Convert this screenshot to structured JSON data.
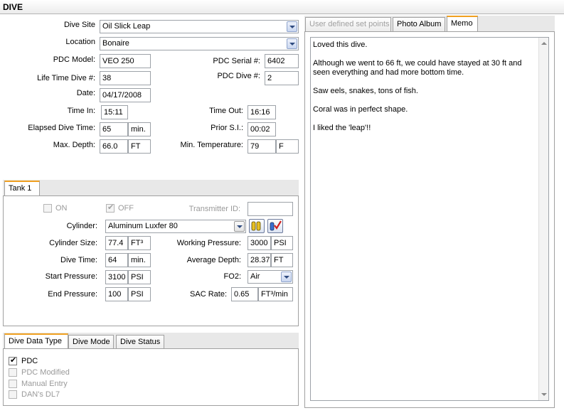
{
  "window": {
    "title": "DIVE"
  },
  "dive": {
    "dive_site_label": "Dive Site",
    "dive_site_value": "Oil Slick Leap",
    "location_label": "Location",
    "location_value": "Bonaire",
    "pdc_model_label": "PDC Model:",
    "pdc_model_value": "VEO 250",
    "pdc_serial_label": "PDC Serial #:",
    "pdc_serial_value": "6402",
    "life_time_dive_label": "Life Time Dive #:",
    "life_time_dive_value": "38",
    "pdc_dive_label": "PDC Dive #:",
    "pdc_dive_value": "2",
    "date_label": "Date:",
    "date_value": "04/17/2008",
    "time_in_label": "Time In:",
    "time_in_value": "15:11",
    "time_out_label": "Time Out:",
    "time_out_value": "16:16",
    "elapsed_label": "Elapsed Dive Time:",
    "elapsed_value": "65",
    "elapsed_unit": "min.",
    "prior_si_label": "Prior S.I.:",
    "prior_si_value": "00:02",
    "max_depth_label": "Max. Depth:",
    "max_depth_value": "66.0",
    "max_depth_unit": "FT",
    "min_temp_label": "Min. Temperature:",
    "min_temp_value": "79",
    "min_temp_unit": "F"
  },
  "tank": {
    "tab_label": "Tank 1",
    "on_label": "ON",
    "off_label": "OFF",
    "transmitter_label": "Transmitter ID:",
    "transmitter_value": "",
    "cylinder_label": "Cylinder:",
    "cylinder_value": "Aluminum Luxfer 80",
    "cylinder_size_label": "Cylinder Size:",
    "cylinder_size_value": "77.4",
    "cylinder_size_unit": "FT³",
    "working_pressure_label": "Working Pressure:",
    "working_pressure_value": "3000",
    "working_pressure_unit": "PSI",
    "dive_time_label": "Dive Time:",
    "dive_time_value": "64",
    "dive_time_unit": "min.",
    "average_depth_label": "Average Depth:",
    "average_depth_value": "28.37",
    "average_depth_unit": "FT",
    "start_pressure_label": "Start Pressure:",
    "start_pressure_value": "3100",
    "start_pressure_unit": "PSI",
    "fo2_label": "FO2:",
    "fo2_value": "Air",
    "end_pressure_label": "End Pressure:",
    "end_pressure_value": "100",
    "end_pressure_unit": "PSI",
    "sac_rate_label": "SAC Rate:",
    "sac_rate_value": "0.65",
    "sac_rate_unit": "FT³/min"
  },
  "data_type": {
    "tabs": [
      "Dive Data Type",
      "Dive Mode",
      "Dive Status"
    ],
    "options": [
      {
        "label": "PDC",
        "checked": true,
        "enabled": true
      },
      {
        "label": "PDC Modified",
        "checked": false,
        "enabled": false
      },
      {
        "label": "Manual Entry",
        "checked": false,
        "enabled": false
      },
      {
        "label": "DAN's DL7",
        "checked": false,
        "enabled": false
      }
    ]
  },
  "right_panel": {
    "tabs": [
      "User defined set points",
      "Photo Album",
      "Memo"
    ],
    "memo_lines": [
      "Loved this dive.",
      "Although we went to 66 ft, we could have stayed at 30 ft and seen everything and had more bottom time.",
      "Saw eels, snakes, tons of fish.",
      "Coral was in perfect shape.",
      "",
      "I liked the 'leap'!!"
    ]
  },
  "icons": {
    "check": "✔",
    "cylinder_add": "tanks-icon",
    "cylinder_edit": "tank-check-icon"
  },
  "colors": {
    "active_tab_accent": "#f0a020",
    "border": "#9da2a8"
  }
}
